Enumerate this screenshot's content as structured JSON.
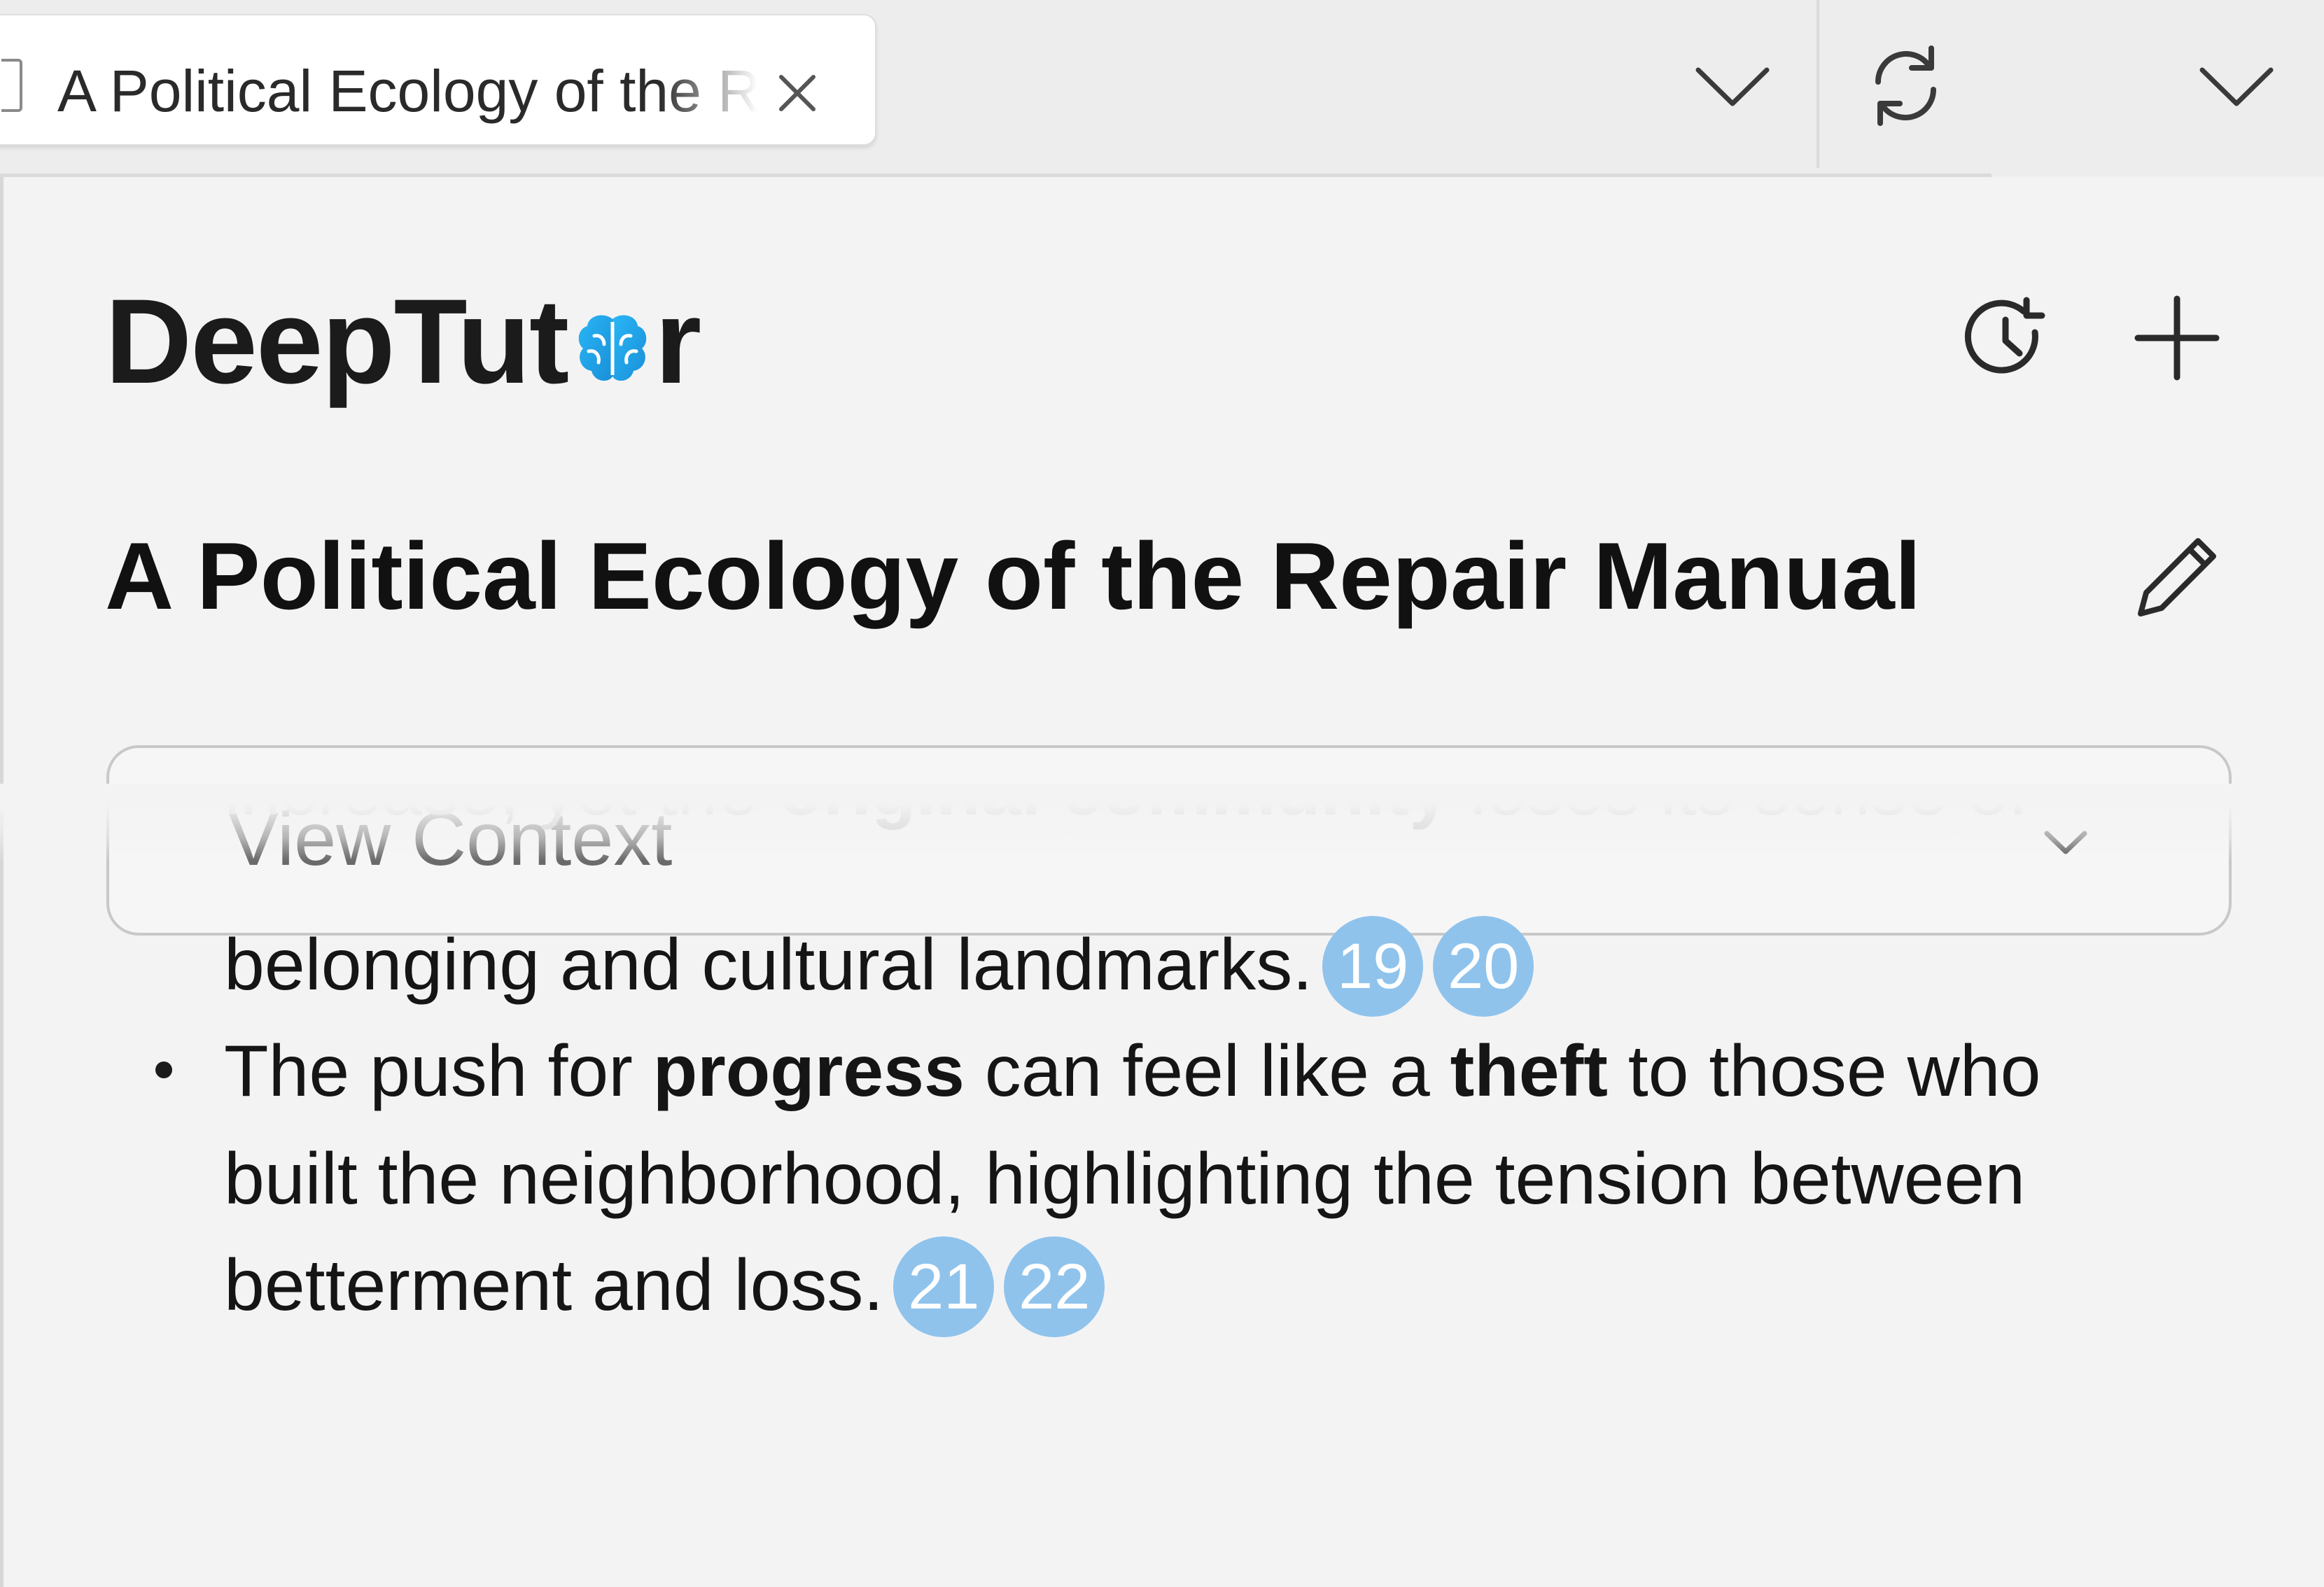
{
  "tab": {
    "title": "A Political Ecology of the Repair Manual",
    "close_icon": "close-icon"
  },
  "tabbar": {
    "tab_list_icon": "chevron-down-icon",
    "refresh_icon": "refresh-icon",
    "panel_menu_icon": "chevron-down-icon"
  },
  "app": {
    "logo_prefix": "DeepTut",
    "logo_suffix": "r",
    "logo_icon": "brain-icon",
    "history_icon": "history-icon",
    "new_chat_icon": "plus-icon",
    "accent_color": "#1aa7ec"
  },
  "session": {
    "title": "A Political Ecology of the Repair Manual",
    "edit_icon": "pencil-icon"
  },
  "context": {
    "label": "View Context",
    "chevron_icon": "chevron-down-icon"
  },
  "message": {
    "faded_line": {
      "t1": "increase, yet the ",
      "b1": "original community",
      "t2": " loses its sense of"
    },
    "line_belonging": "belonging and cultural landmarks.",
    "citations_a": [
      "19",
      "20"
    ],
    "bullet": {
      "t1": "The push for ",
      "b1": "progress",
      "t2": " can feel like a ",
      "b2": "theft",
      "t3": " to those who",
      "line2": "built the neighborhood, highlighting the tension between",
      "line3": "betterment and loss."
    },
    "citations_b": [
      "21",
      "22"
    ],
    "citation_color": "#8fc3ec"
  }
}
